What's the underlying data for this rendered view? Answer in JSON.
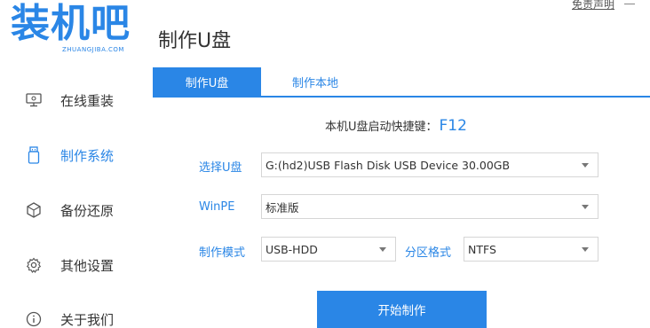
{
  "app": {
    "logo_text": "装机吧",
    "logo_subtext": "ZHUANGJIBA.COM",
    "disclaimer": "免责声明",
    "accent_color": "#2a86e6"
  },
  "sidebar": {
    "items": [
      {
        "label": "在线重装",
        "icon": "monitor-icon",
        "active": false
      },
      {
        "label": "制作系统",
        "icon": "usb-drive-icon",
        "active": true
      },
      {
        "label": "备份还原",
        "icon": "backup-cube-icon",
        "active": false
      },
      {
        "label": "其他设置",
        "icon": "gear-icon",
        "active": false
      },
      {
        "label": "关于我们",
        "icon": "info-icon",
        "active": false
      }
    ]
  },
  "main": {
    "title": "制作U盘",
    "tabs": [
      {
        "label": "制作U盘",
        "active": true
      },
      {
        "label": "制作本地",
        "active": false
      }
    ],
    "hotkey": {
      "label": "本机U盘启动快捷键：",
      "key": "F12"
    },
    "form": {
      "usb": {
        "label": "选择U盘",
        "value": "G:(hd2)USB Flash Disk USB Device 30.00GB"
      },
      "winpe": {
        "label": "WinPE",
        "value": "标准版"
      },
      "mode": {
        "label": "制作模式",
        "value": "USB-HDD"
      },
      "partition": {
        "label": "分区格式",
        "value": "NTFS"
      }
    },
    "start_button": "开始制作"
  }
}
